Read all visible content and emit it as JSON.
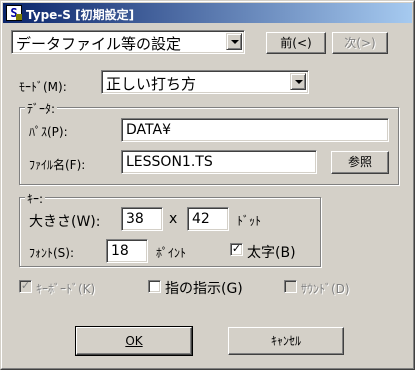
{
  "window": {
    "icon": "S",
    "title": "Type-S [初期設定]"
  },
  "top": {
    "file_combo_value": "データファイル等の設定",
    "prev_button": "前(<)",
    "next_button": "次(>)"
  },
  "mode": {
    "label": "ﾓｰﾄﾞ(M):",
    "combo_value": "正しい打ち方"
  },
  "data_group": {
    "title": "ﾃﾞｰﾀ:",
    "path_label": "ﾊﾟｽ(P):",
    "path_value": "DATA¥",
    "filename_label": "ﾌｧｲﾙ名(F):",
    "filename_value": "LESSON1.TS",
    "browse_button": "参照"
  },
  "key_group": {
    "title": "ｷｰ:",
    "size_label": "大きさ(W):",
    "width_value": "38",
    "times": "x",
    "height_value": "42",
    "dot_unit": "ﾄﾞｯﾄ",
    "font_label": "ﾌｫﾝﾄ(S):",
    "font_value": "18",
    "point_unit": "ﾎﾟｲﾝﾄ",
    "bold_label": "太字(B)",
    "bold_checked": true
  },
  "options": {
    "keyboard_label": "ｷｰﾎﾞｰﾄﾞ(K)",
    "finger_label": "指の指示(G)",
    "sound_label": "ｻｳﾝﾄﾞ(D)"
  },
  "buttons": {
    "ok": "OK",
    "cancel": "ｷｬﾝｾﾙ"
  }
}
